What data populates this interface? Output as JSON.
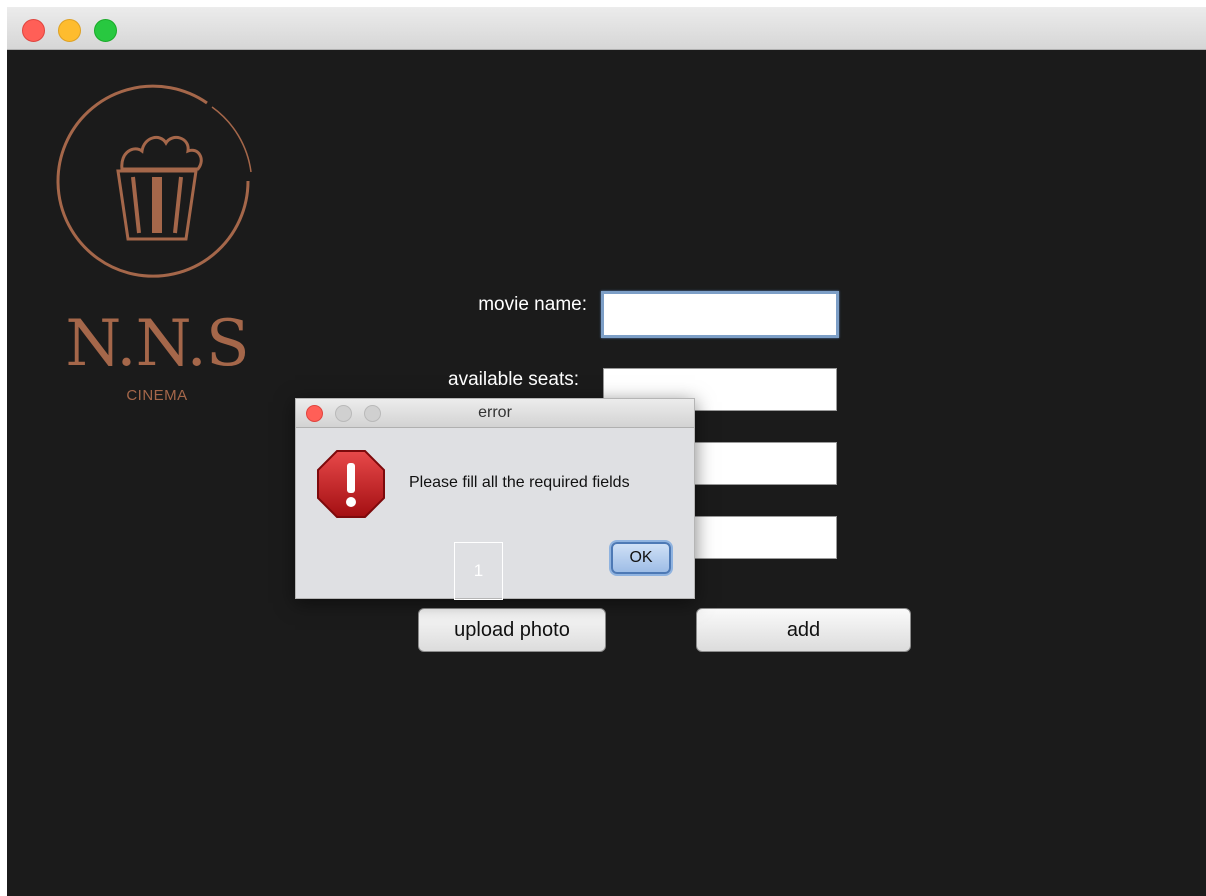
{
  "window": {
    "traffic_lights": [
      "close",
      "minimize",
      "zoom"
    ]
  },
  "logo": {
    "title": "N.N.S",
    "subtitle": "CINEMA",
    "color": "#a5674a",
    "icon": "popcorn-icon"
  },
  "form": {
    "movie_name_label": "movie name:",
    "movie_name_value": "",
    "available_seats_label": "available seats:",
    "available_seats_value": "",
    "field3_value": "",
    "field4_value": ""
  },
  "buttons": {
    "upload_photo": "upload photo",
    "add": "add"
  },
  "dialog": {
    "title": "error",
    "message": "Please fill all the required fields",
    "ok_label": "OK",
    "marker": "1",
    "icon": "stop-warning-icon"
  }
}
